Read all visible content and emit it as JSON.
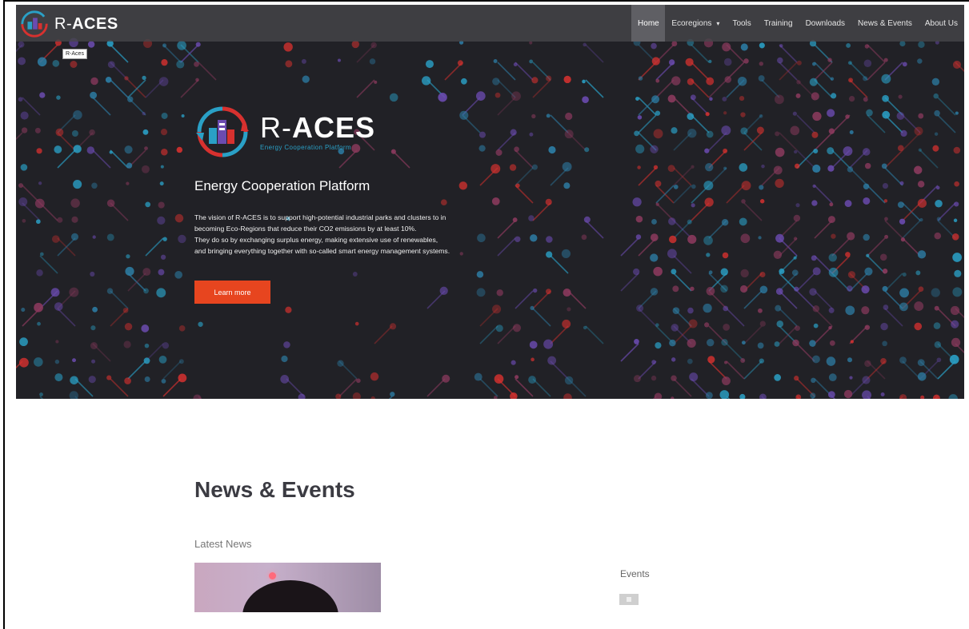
{
  "brand": {
    "logo_text_prefix": "R-",
    "logo_text_main": "ACES",
    "tagline": "Energy Cooperation Platform",
    "tooltip": "R-Aces"
  },
  "nav": {
    "items": [
      {
        "label": "Home",
        "active": true
      },
      {
        "label": "Ecoregions",
        "dropdown": true
      },
      {
        "label": "Tools"
      },
      {
        "label": "Training"
      },
      {
        "label": "Downloads"
      },
      {
        "label": "News & Events"
      },
      {
        "label": "About Us"
      }
    ],
    "dropdown_caret": "▾"
  },
  "hero": {
    "heading": "Energy Cooperation Platform",
    "paragraph1": "The vision of R-ACES is to support high-potential industrial parks and clusters to in becoming Eco-Regions that reduce their CO2 emissions by at least 10%.",
    "paragraph2": "They do so by exchanging surplus energy, making extensive use of renewables, and bringing everything together with so-called smart energy management systems.",
    "cta_label": "Learn more"
  },
  "news": {
    "section_title": "News & Events",
    "latest_news_label": "Latest News",
    "events_label": "Events"
  },
  "colors": {
    "hero_bg": "#212126",
    "accent_orange": "#e7451f",
    "accent_blue": "#2aa0c6",
    "accent_red": "#d7312f",
    "accent_purple": "#6b4bb0",
    "heading_text": "#3b3b42"
  },
  "icons": {
    "logo": "r-aces-logo-icon",
    "dropdown": "chevron-down-icon"
  }
}
